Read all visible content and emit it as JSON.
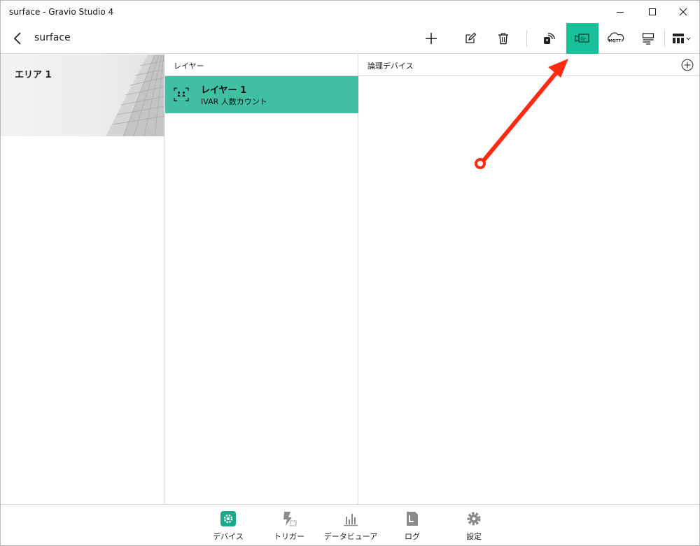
{
  "window": {
    "title": "surface - Gravio Studio 4"
  },
  "header": {
    "title": "surface",
    "toolbar": [
      {
        "icon": "add-icon"
      },
      {
        "icon": "edit-icon"
      },
      {
        "icon": "trash-icon"
      },
      {
        "icon": "nfc-icon"
      },
      {
        "icon": "gravio-camera-icon",
        "active": true
      },
      {
        "icon": "mqtt-icon",
        "text": "MQTT"
      },
      {
        "icon": "list-view-icon"
      },
      {
        "icon": "layout-dropdown-icon"
      }
    ]
  },
  "areas": {
    "items": [
      {
        "name": "エリア 1"
      }
    ]
  },
  "layers": {
    "header": "レイヤー",
    "items": [
      {
        "name": "レイヤー 1",
        "type": "IVAR 人数カウント"
      }
    ]
  },
  "devices": {
    "header": "論理デバイス"
  },
  "bottom_nav": {
    "items": [
      {
        "label": "デバイス",
        "icon": "gear-device-icon",
        "active": true
      },
      {
        "label": "トリガー",
        "icon": "trigger-icon"
      },
      {
        "label": "データビューア",
        "icon": "data-viewer-icon"
      },
      {
        "label": "ログ",
        "icon": "log-icon"
      },
      {
        "label": "設定",
        "icon": "settings-icon"
      }
    ]
  },
  "colors": {
    "accent": "#17c29a",
    "selected_layer": "#40bfa2",
    "annotation_arrow": "#ff2a12"
  }
}
